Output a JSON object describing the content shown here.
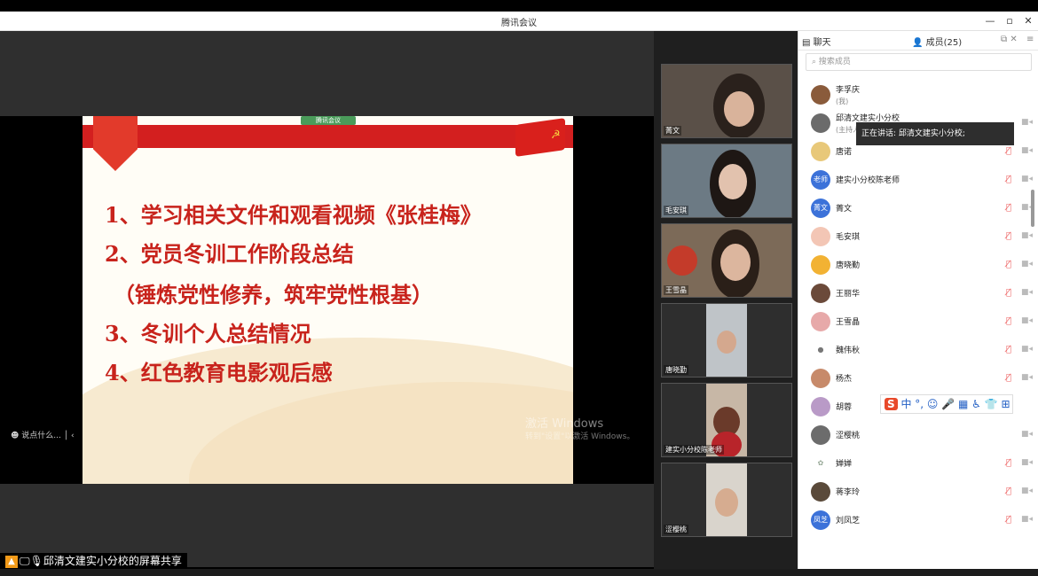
{
  "window": {
    "title": "腾讯会议",
    "minimize": "—",
    "restore": "▫",
    "close": "✕"
  },
  "slide": {
    "toolbar": "腾讯会议",
    "items": [
      "1、学习相关文件和观看视频《张桂梅》",
      "2、党员冬训工作阶段总结",
      "（锤炼党性修养，筑牢党性根基）",
      "3、冬训个人总结情况",
      "4、红色教育电影观后感"
    ]
  },
  "activate": {
    "title": "激活 Windows",
    "sub": "转到\"设置\"以激活 Windows。"
  },
  "speak": "说点什么...",
  "share_label": "邱清文建实小分校的屏幕共享",
  "gallery": [
    {
      "name": "菁文"
    },
    {
      "name": "毛安琪"
    },
    {
      "name": "王雪晶"
    },
    {
      "name": "唐晓勤"
    },
    {
      "name": "建实小分校陈老师"
    },
    {
      "name": "涩樱桃"
    }
  ],
  "panel": {
    "tab_chat": "聊天",
    "tab_members": "成员(25)",
    "search_placeholder": "搜索成员",
    "tooltip": "正在讲话: 邱清文建实小分校;",
    "members": [
      {
        "name": "李孚庆",
        "sub": "(我)",
        "avatar": "",
        "color": "#8a5b3b"
      },
      {
        "name": "邱清文建实小分校",
        "sub": "(主持人)",
        "avatar": "",
        "color": "#6b6b6b"
      },
      {
        "name": "唐诺",
        "avatar": "",
        "color": "#e8c879"
      },
      {
        "name": "建实小分校陈老师",
        "avatar": "老师",
        "color": "#3c72d9"
      },
      {
        "name": "菁文",
        "avatar": "菁文",
        "color": "#3c72d9"
      },
      {
        "name": "毛安琪",
        "avatar": "",
        "color": "#f3c6b5"
      },
      {
        "name": "唐晓勤",
        "avatar": "",
        "color": "#f2b233"
      },
      {
        "name": "王丽华",
        "avatar": "",
        "color": "#6b4a3a"
      },
      {
        "name": "王雪晶",
        "avatar": "",
        "color": "#e7a9a9"
      },
      {
        "name": "魏伟秋",
        "avatar": "",
        "color": "#ffffff"
      },
      {
        "name": "杨杰",
        "avatar": "",
        "color": "#c78a6a"
      },
      {
        "name": "胡蓉",
        "avatar": "",
        "color": "#b99ac7"
      },
      {
        "name": "涩樱桃",
        "avatar": "",
        "color": "#6c6c6c"
      },
      {
        "name": "婵婵",
        "avatar": "",
        "color": "#ffffff"
      },
      {
        "name": "蒋李玲",
        "avatar": "",
        "color": "#5a4a3a"
      },
      {
        "name": "刘凤芝",
        "avatar": "凤芝",
        "color": "#3c72d9"
      }
    ]
  },
  "ime": {
    "logo": "S",
    "text": "中 °, ☺ 🎤 ▦ ♿ 👕 ⊞"
  }
}
